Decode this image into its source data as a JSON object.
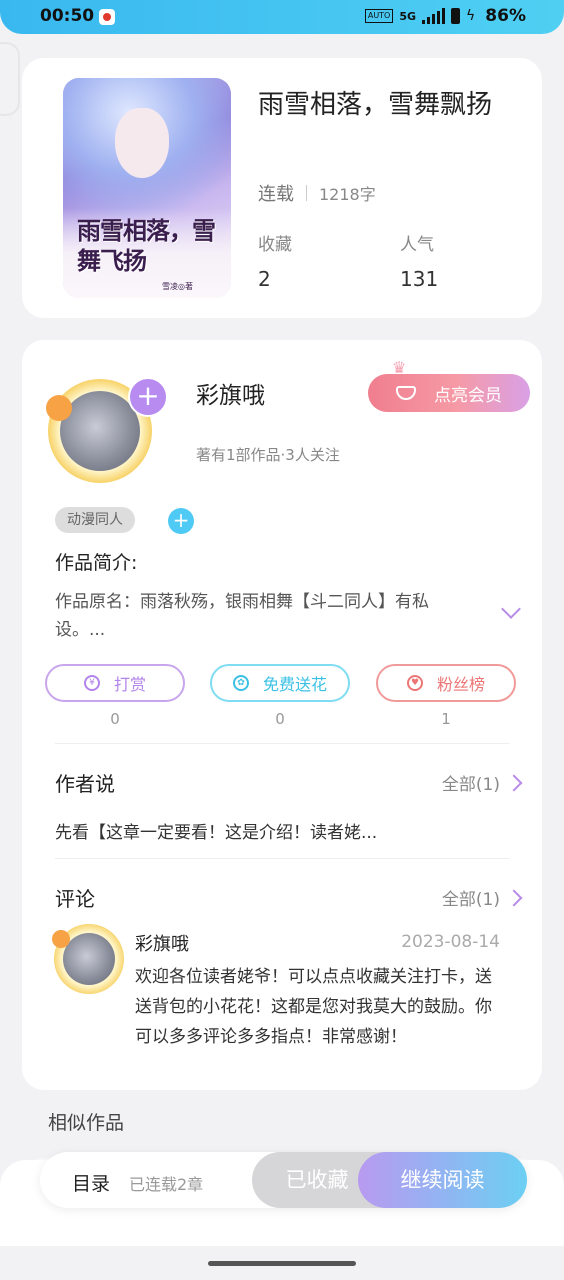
{
  "status_bar": {
    "time": "00:50",
    "auto": "AUTO",
    "network": "5G",
    "battery": "86%"
  },
  "book": {
    "title": "雨雪相落，雪舞飘扬",
    "cover_title": "雨雪相落，雪舞飞扬",
    "cover_author": "雪凌◎著",
    "status": "连载",
    "words": "1218字",
    "stats": [
      {
        "label": "收藏",
        "value": "2"
      },
      {
        "label": "人气",
        "value": "131"
      }
    ]
  },
  "author": {
    "name": "彩旗哦",
    "subtitle": "著有1部作品·3人关注",
    "vip_label": "点亮会员",
    "tag": "动漫同人",
    "intro_heading": "作品简介:",
    "intro_text": "作品原名：雨落秋殇，银雨相舞【斗二同人】有私设。..."
  },
  "actions": [
    {
      "label": "打赏",
      "count": "0",
      "icon": "yen-icon"
    },
    {
      "label": "免费送花",
      "count": "0",
      "icon": "flower-icon"
    },
    {
      "label": "粉丝榜",
      "count": "1",
      "icon": "fan-icon"
    }
  ],
  "author_says": {
    "heading": "作者说",
    "all": "全部(1)",
    "text": "先看【这章一定要看！这是介绍！读者姥..."
  },
  "comments": {
    "heading": "评论",
    "all": "全部(1)",
    "items": [
      {
        "name": "彩旗哦",
        "date": "2023-08-14",
        "text": "欢迎各位读者姥爷！可以点点收藏关注打卡，送送背包的小花花！这都是您对我莫大的鼓励。你可以多多评论多多指点！非常感谢！"
      }
    ]
  },
  "similar_heading": "相似作品",
  "bottom_bar": {
    "toc": "目录",
    "chapters": "已连载2章",
    "collected": "已收藏",
    "continue": "继续阅读"
  }
}
